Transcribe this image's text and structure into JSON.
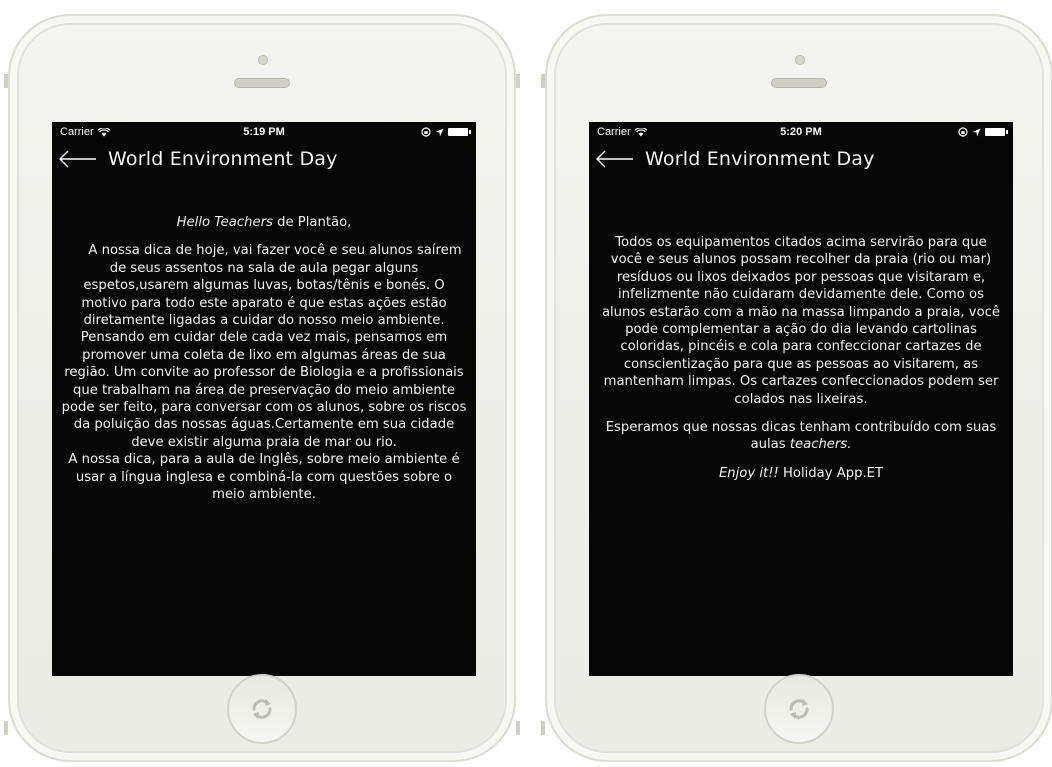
{
  "phones": [
    {
      "status": {
        "carrier": "Carrier",
        "time": "5:19 PM"
      },
      "nav": {
        "title": "World Environment Day"
      },
      "content": {
        "greeting_em": "Hello Teachers",
        "greeting_rest": " de Plantão,",
        "p1": "A nossa dica de hoje, vai fazer você e seu alunos saírem de seus assentos na sala de aula pegar alguns espetos,usarem algumas luvas, botas/tênis e bonés. O motivo para todo este aparato é que estas ações estão diretamente ligadas a cuidar do nosso meio ambiente.",
        "p2": "Pensando em cuidar dele cada vez mais, pensamos em promover uma coleta de lixo em algumas áreas de sua região. Um convite ao professor de Biologia e a profissionais que trabalham na área de preservação do meio ambiente pode ser feito, para conversar com os alunos, sobre os riscos da poluição das nossas águas.Certamente em sua cidade deve existir alguma praia de mar ou rio.",
        "p3": "A nossa dica, para a aula de Inglês, sobre meio ambiente é usar a língua inglesa e combiná-la com questões sobre o meio ambiente."
      }
    },
    {
      "status": {
        "carrier": "Carrier",
        "time": "5:20 PM"
      },
      "nav": {
        "title": "World Environment Day"
      },
      "content": {
        "p1": "Todos os equipamentos citados acima servirão para que você e seus alunos possam recolher da praia (rio ou mar) resíduos ou lixos deixados por pessoas que visitaram e, infelizmente não cuidaram devidamente dele. Como os alunos estarão com a mão na massa limpando a praia, você pode complementar a ação do dia levando cartolinas coloridas, pincéis e cola para confeccionar cartazes de conscientização para que as pessoas ao visitarem, as mantenham limpas. Os cartazes confeccionados podem ser colados nas lixeiras.",
        "p2_text": "Esperamos que nossas dicas tenham contribuído com suas aulas ",
        "p2_em": "teachers.",
        "p3_em": "Enjoy it!!",
        "p3_rest": " Holiday App.ET"
      }
    }
  ],
  "icons": {
    "wifi": "wifi-icon",
    "location": "location-arrow-icon",
    "lock": "rotation-lock-icon",
    "battery": "battery-icon",
    "back": "back-arrow-icon",
    "home": "home-button-icon"
  },
  "colors": {
    "screen_bg": "#050505",
    "text": "#f2f2f2",
    "phone_body": "#eeeee9"
  }
}
